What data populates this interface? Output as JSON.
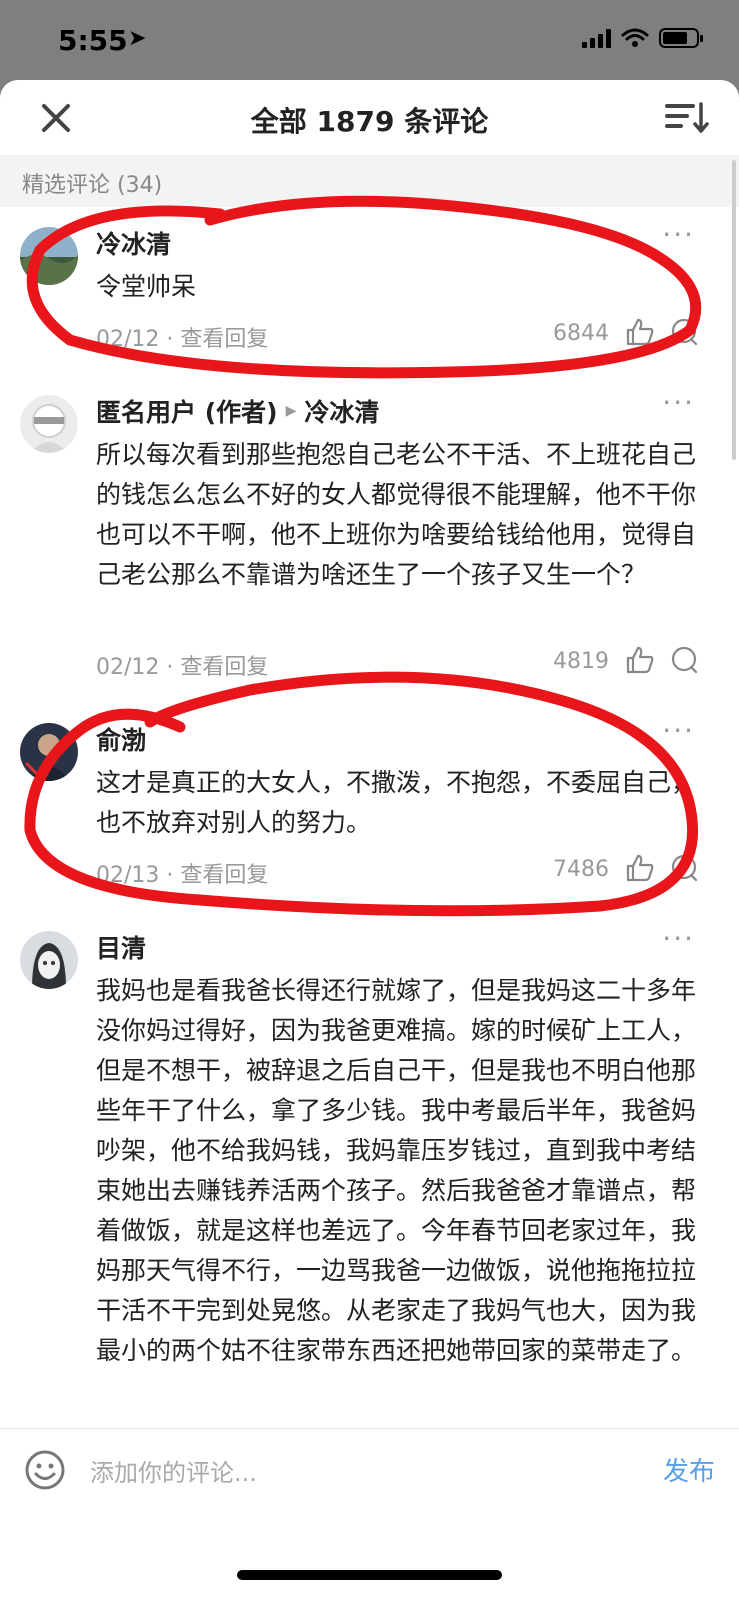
{
  "status_bar": {
    "time": "5:55",
    "location_icon": "location-arrow-icon"
  },
  "header": {
    "title": "全部 1879 条评论",
    "close_icon": "close-icon",
    "sort_icon": "sort-icon"
  },
  "section": {
    "label": "精选评论 (34)"
  },
  "comments": [
    {
      "name": "冷冰清",
      "reply_to": "",
      "text": "令堂帅呆",
      "date": "02/12 · 查看回复",
      "likes": "6844"
    },
    {
      "name": "匿名用户 (作者)",
      "reply_to": "冷冰清",
      "text": "所以每次看到那些抱怨自己老公不干活、不上班花自己的钱怎么怎么不好的女人都觉得很不能理解，他不干你也可以不干啊，他不上班你为啥要给钱给他用，觉得自己老公那么不靠谱为啥还生了一个孩子又生一个？",
      "date": "02/12 · 查看回复",
      "likes": "4819"
    },
    {
      "name": "俞渤",
      "reply_to": "",
      "text": "这才是真正的大女人，不撒泼，不抱怨，不委屈自己，也不放弃对别人的努力。",
      "date": "02/13 · 查看回复",
      "likes": "7486"
    },
    {
      "name": "目清",
      "reply_to": "",
      "text": "我妈也是看我爸长得还行就嫁了，但是我妈这二十多年没你妈过得好，因为我爸更难搞。嫁的时候矿上工人，但是不想干，被辞退之后自己干，但是我也不明白他那些年干了什么，拿了多少钱。我中考最后半年，我爸妈吵架，他不给我妈钱，我妈靠压岁钱过，直到我中考结束她出去赚钱养活两个孩子。然后我爸爸才靠谱点，帮着做饭，就是这样也差远了。今年春节回老家过年，我妈那天气得不行，一边骂我爸一边做饭，说他拖拖拉拉干活不干完到处晃悠。从老家走了我妈气也大，因为我最小的两个姑不往家带东西还把她带回家的菜带走了。",
      "date": "",
      "likes": ""
    }
  ],
  "bottom_bar": {
    "placeholder": "添加你的评论...",
    "publish": "发布"
  },
  "colors": {
    "accent": "#5aa0e8",
    "annotation": "#e8161a"
  }
}
